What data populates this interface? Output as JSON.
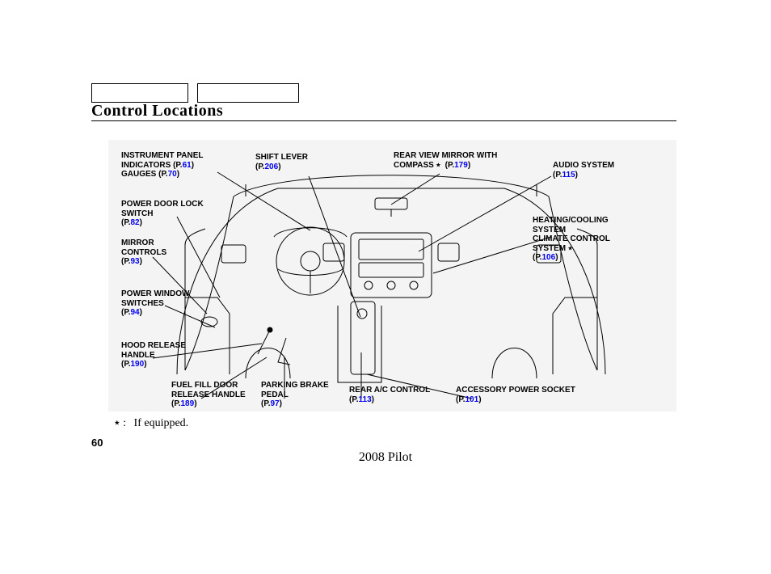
{
  "section_title": "Control Locations",
  "page_number": "60",
  "model_line": "2008  Pilot",
  "footnote": "If equipped.",
  "callouts": {
    "instrument_panel_l1": "INSTRUMENT PANEL",
    "instrument_panel_l2a": "INDICATORS",
    "instrument_panel_p1_open": "(P.",
    "instrument_panel_p1_num": "61",
    "instrument_panel_p1_close": ")",
    "instrument_panel_l3a": "GAUGES",
    "instrument_panel_p2_open": "(P.",
    "instrument_panel_p2_num": "70",
    "instrument_panel_p2_close": ")",
    "power_door_l1": "POWER DOOR LOCK",
    "power_door_l2": "SWITCH",
    "power_door_p_open": "(P.",
    "power_door_p_num": "82",
    "power_door_p_close": ")",
    "mirror_l1": "MIRROR",
    "mirror_l2": "CONTROLS",
    "mirror_p_open": "(P.",
    "mirror_p_num": "93",
    "mirror_p_close": ")",
    "power_window_l1": "POWER WINDOW",
    "power_window_l2": "SWITCHES",
    "power_window_p_open": "(P.",
    "power_window_p_num": "94",
    "power_window_p_close": ")",
    "hood_l1": "HOOD RELEASE",
    "hood_l2": "HANDLE",
    "hood_p_open": "(P.",
    "hood_p_num": "190",
    "hood_p_close": ")",
    "fuel_l1": "FUEL FILL DOOR",
    "fuel_l2": "RELEASE HANDLE",
    "fuel_p_open": "(P.",
    "fuel_p_num": "189",
    "fuel_p_close": ")",
    "parking_l1": "PARKING BRAKE",
    "parking_l2": "PEDAL",
    "parking_p_open": "(P.",
    "parking_p_num": "97",
    "parking_p_close": ")",
    "shift_l1": "SHIFT LEVER",
    "shift_p_open": "(P.",
    "shift_p_num": "206",
    "shift_p_close": ")",
    "rearview_l1": "REAR VIEW MIRROR WITH",
    "rearview_l2": "COMPASS",
    "rearview_star": "٭",
    "rearview_p_open": "(P.",
    "rearview_p_num": "179",
    "rearview_p_close": ")",
    "rearac_l1": "REAR A/C CONTROL",
    "rearac_p_open": "(P.",
    "rearac_p_num": "113",
    "rearac_p_close": ")",
    "accessory_l1": "ACCESSORY POWER SOCKET",
    "accessory_p_open": "(P.",
    "accessory_p_num": "101",
    "accessory_p_close": ")",
    "audio_l1": "AUDIO SYSTEM",
    "audio_p_open": "(P.",
    "audio_p_num": "115",
    "audio_p_close": ")",
    "hvac_l1": "HEATING/COOLING",
    "hvac_l2": "SYSTEM",
    "hvac_l3": "CLIMATE CONTROL",
    "hvac_l4": "SYSTEM",
    "hvac_star": "٭",
    "hvac_p_open": "(P.",
    "hvac_p_num": "106",
    "hvac_p_close": ")"
  }
}
